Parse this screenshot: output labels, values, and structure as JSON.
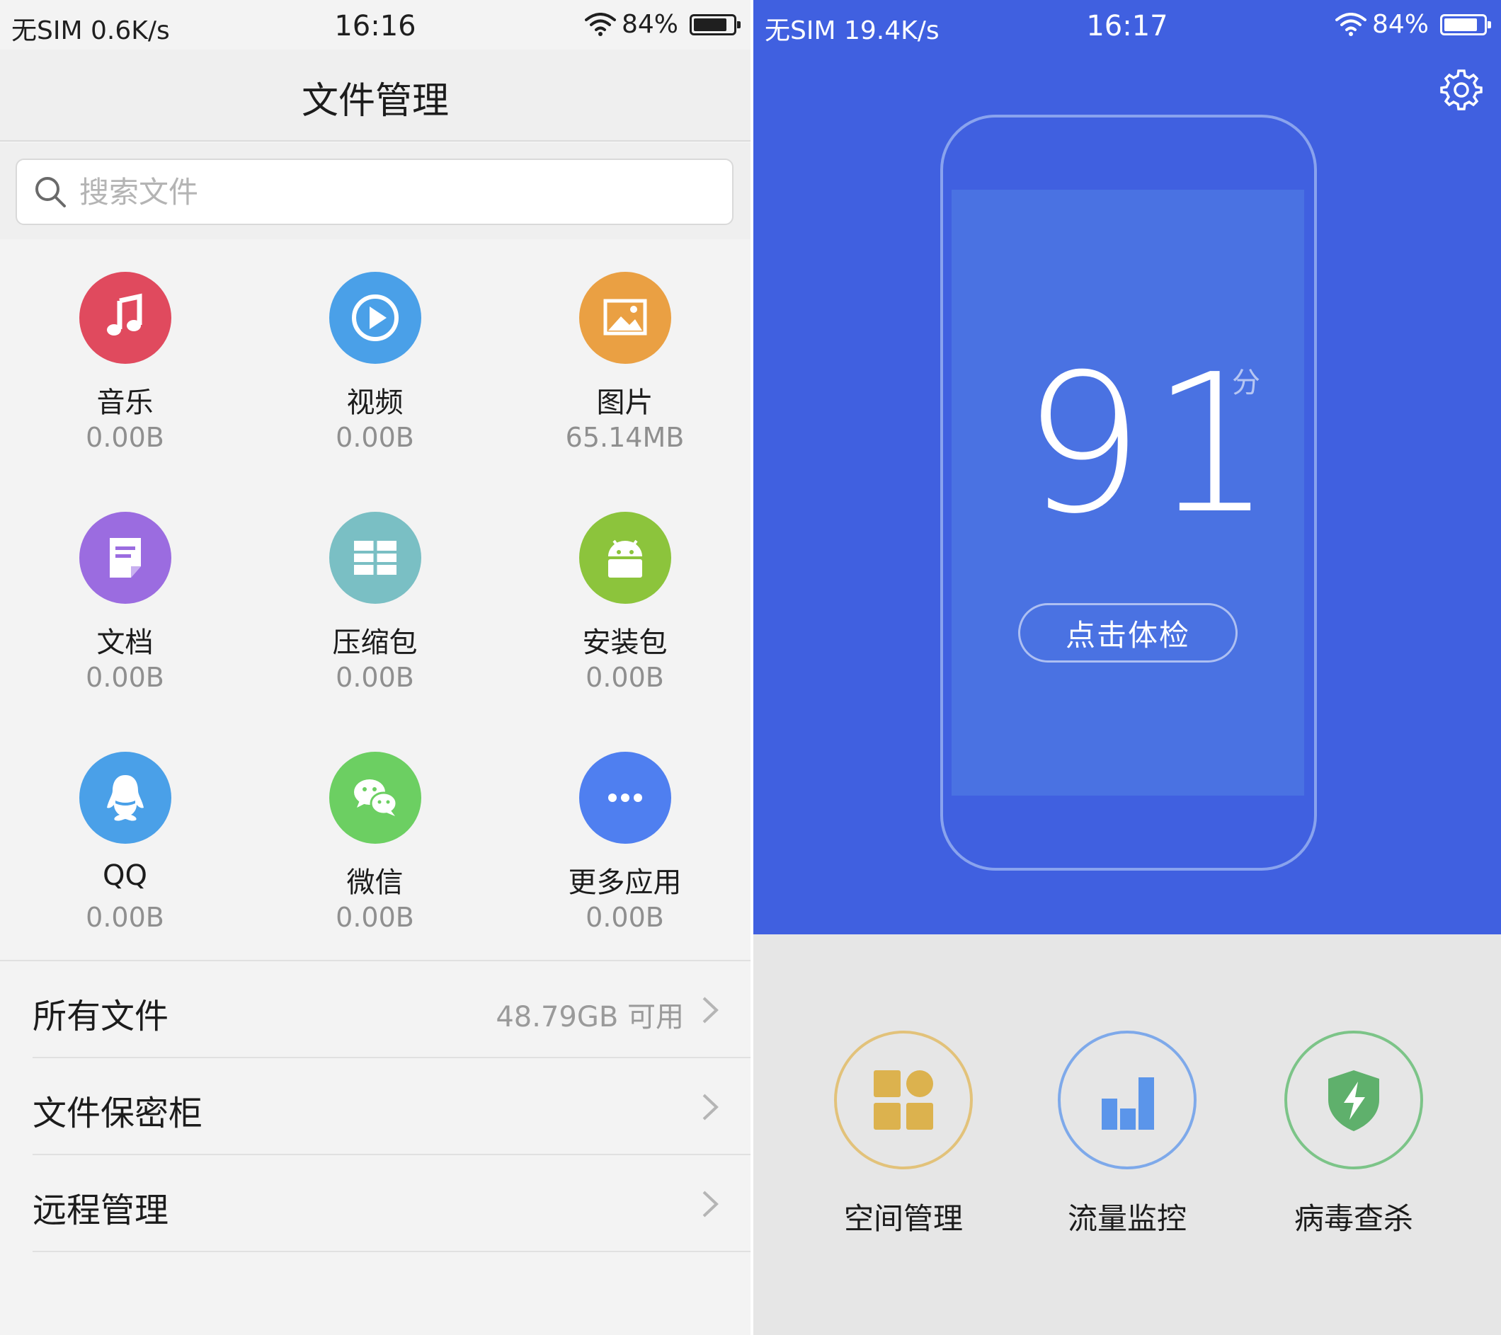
{
  "left_screen": {
    "status_bar": {
      "carrier": "无SIM 0.6K/s",
      "time": "16:16",
      "battery": "84%"
    },
    "title": "文件管理",
    "search": {
      "placeholder": "搜索文件",
      "icon": "search-icon"
    },
    "categories": [
      {
        "label": "音乐",
        "size": "0.00B",
        "icon": "music-icon",
        "color": "#e04a5e"
      },
      {
        "label": "视频",
        "size": "0.00B",
        "icon": "video-icon",
        "color": "#4aa0e8"
      },
      {
        "label": "图片",
        "size": "65.14MB",
        "icon": "picture-icon",
        "color": "#eaa043"
      },
      {
        "label": "文档",
        "size": "0.00B",
        "icon": "document-icon",
        "color": "#9b6ce0"
      },
      {
        "label": "压缩包",
        "size": "0.00B",
        "icon": "archive-icon",
        "color": "#7abfc4"
      },
      {
        "label": "安装包",
        "size": "0.00B",
        "icon": "android-icon",
        "color": "#8cc43c"
      },
      {
        "label": "QQ",
        "size": "0.00B",
        "icon": "qq-icon",
        "color": "#4aa0e8"
      },
      {
        "label": "微信",
        "size": "0.00B",
        "icon": "wechat-icon",
        "color": "#6ccf62"
      },
      {
        "label": "更多应用",
        "size": "0.00B",
        "icon": "more-icon",
        "color": "#4f7ff0"
      }
    ],
    "list": [
      {
        "title": "所有文件",
        "hint": "48.79GB 可用"
      },
      {
        "title": "文件保密柜",
        "hint": ""
      },
      {
        "title": "远程管理",
        "hint": ""
      }
    ]
  },
  "right_screen": {
    "status_bar": {
      "carrier": "无SIM 19.4K/s",
      "time": "16:17",
      "battery": "84%"
    },
    "settings_icon": "gear-icon",
    "score": "91",
    "score_unit": "分",
    "check_button": "点击体检",
    "tools": [
      {
        "label": "空间管理",
        "icon": "space-manage-icon",
        "color": "#e2c27a"
      },
      {
        "label": "流量监控",
        "icon": "traffic-monitor-icon",
        "color": "#7ea9ea"
      },
      {
        "label": "病毒查杀",
        "icon": "virus-scan-icon",
        "color": "#7cc488"
      }
    ],
    "accent_color": "#4060e0"
  }
}
